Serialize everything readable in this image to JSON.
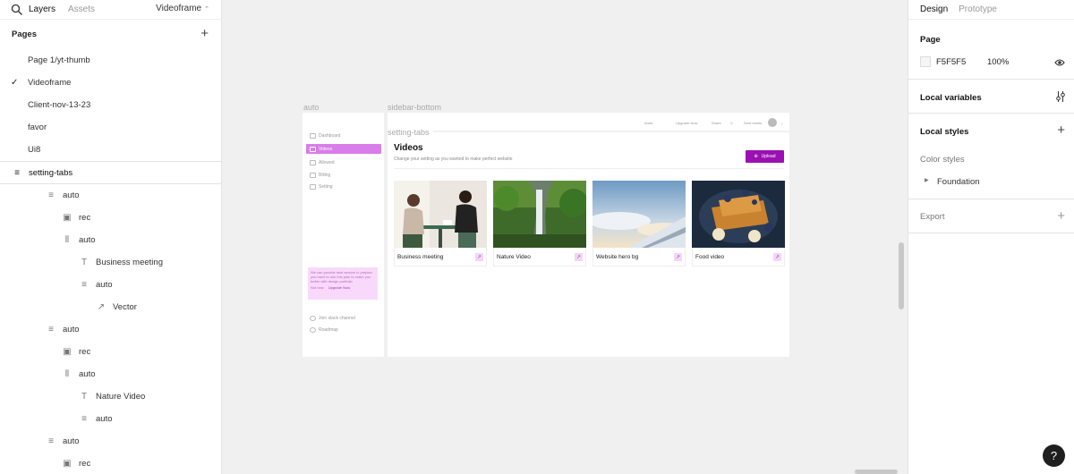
{
  "left_panel": {
    "tabs": [
      "Layers",
      "Assets"
    ],
    "page_selector": "Videoframe",
    "pages_title": "Pages",
    "pages": [
      {
        "label": "Page 1/yt-thumb",
        "checked": false
      },
      {
        "label": "Videoframe",
        "checked": true
      },
      {
        "label": "Client-nov-13-23",
        "checked": false
      },
      {
        "label": "favor",
        "checked": false
      },
      {
        "label": "Ui8",
        "checked": false
      }
    ],
    "layers": [
      {
        "label": "setting-tabs",
        "icon": "auto-layout-vertical-icon"
      },
      {
        "label": "auto",
        "icon": "auto-layout-vertical-icon"
      },
      {
        "label": "rec",
        "icon": "image-icon"
      },
      {
        "label": "auto",
        "icon": "auto-layout-horizontal-icon"
      },
      {
        "label": "Business meeting",
        "icon": "text-icon"
      },
      {
        "label": "auto",
        "icon": "auto-layout-vertical-icon"
      },
      {
        "label": "Vector",
        "icon": "vector-arrow-icon"
      },
      {
        "label": "auto",
        "icon": "auto-layout-vertical-icon"
      },
      {
        "label": "rec",
        "icon": "image-icon"
      },
      {
        "label": "auto",
        "icon": "auto-layout-horizontal-icon"
      },
      {
        "label": "Nature Video",
        "icon": "text-icon"
      },
      {
        "label": "auto",
        "icon": "auto-layout-vertical-icon"
      },
      {
        "label": "auto",
        "icon": "auto-layout-vertical-icon"
      },
      {
        "label": "rec",
        "icon": "image-icon"
      }
    ]
  },
  "canvas": {
    "frame_labels": {
      "auto": "auto",
      "sidebar_bottom": "sidebar-bottom",
      "setting_tabs": "setting-tabs"
    },
    "mini_sidebar": {
      "nav": [
        "Dashboard",
        "Videos",
        "Allowed",
        "Billing",
        "Setting"
      ],
      "promo_text": "We can provide best service in preplan you have to use this plan to make you better with design portfolio",
      "promo_links": [
        "Not now",
        "Upgrade Now"
      ],
      "bottom": [
        "Join slack channel",
        "Roadmap"
      ]
    },
    "mini_main": {
      "topbar": [
        "Invite",
        "Upgrade Now",
        "Share",
        "Sent meets"
      ],
      "title": "Videos",
      "subtitle": "Change your setting as you wanted to make perfect website",
      "upload_label": "Upload",
      "cards": [
        {
          "label": "Business meeting"
        },
        {
          "label": "Nature Video"
        },
        {
          "label": "Website hero bg"
        },
        {
          "label": "Food video"
        }
      ]
    }
  },
  "right_panel": {
    "tabs": [
      "Design",
      "Prototype"
    ],
    "page_section": {
      "title": "Page",
      "color": "F5F5F5",
      "opacity": "100%"
    },
    "local_variables": "Local variables",
    "local_styles": "Local styles",
    "color_styles": "Color styles",
    "foundation": "Foundation",
    "export": "Export"
  },
  "help_label": "?"
}
